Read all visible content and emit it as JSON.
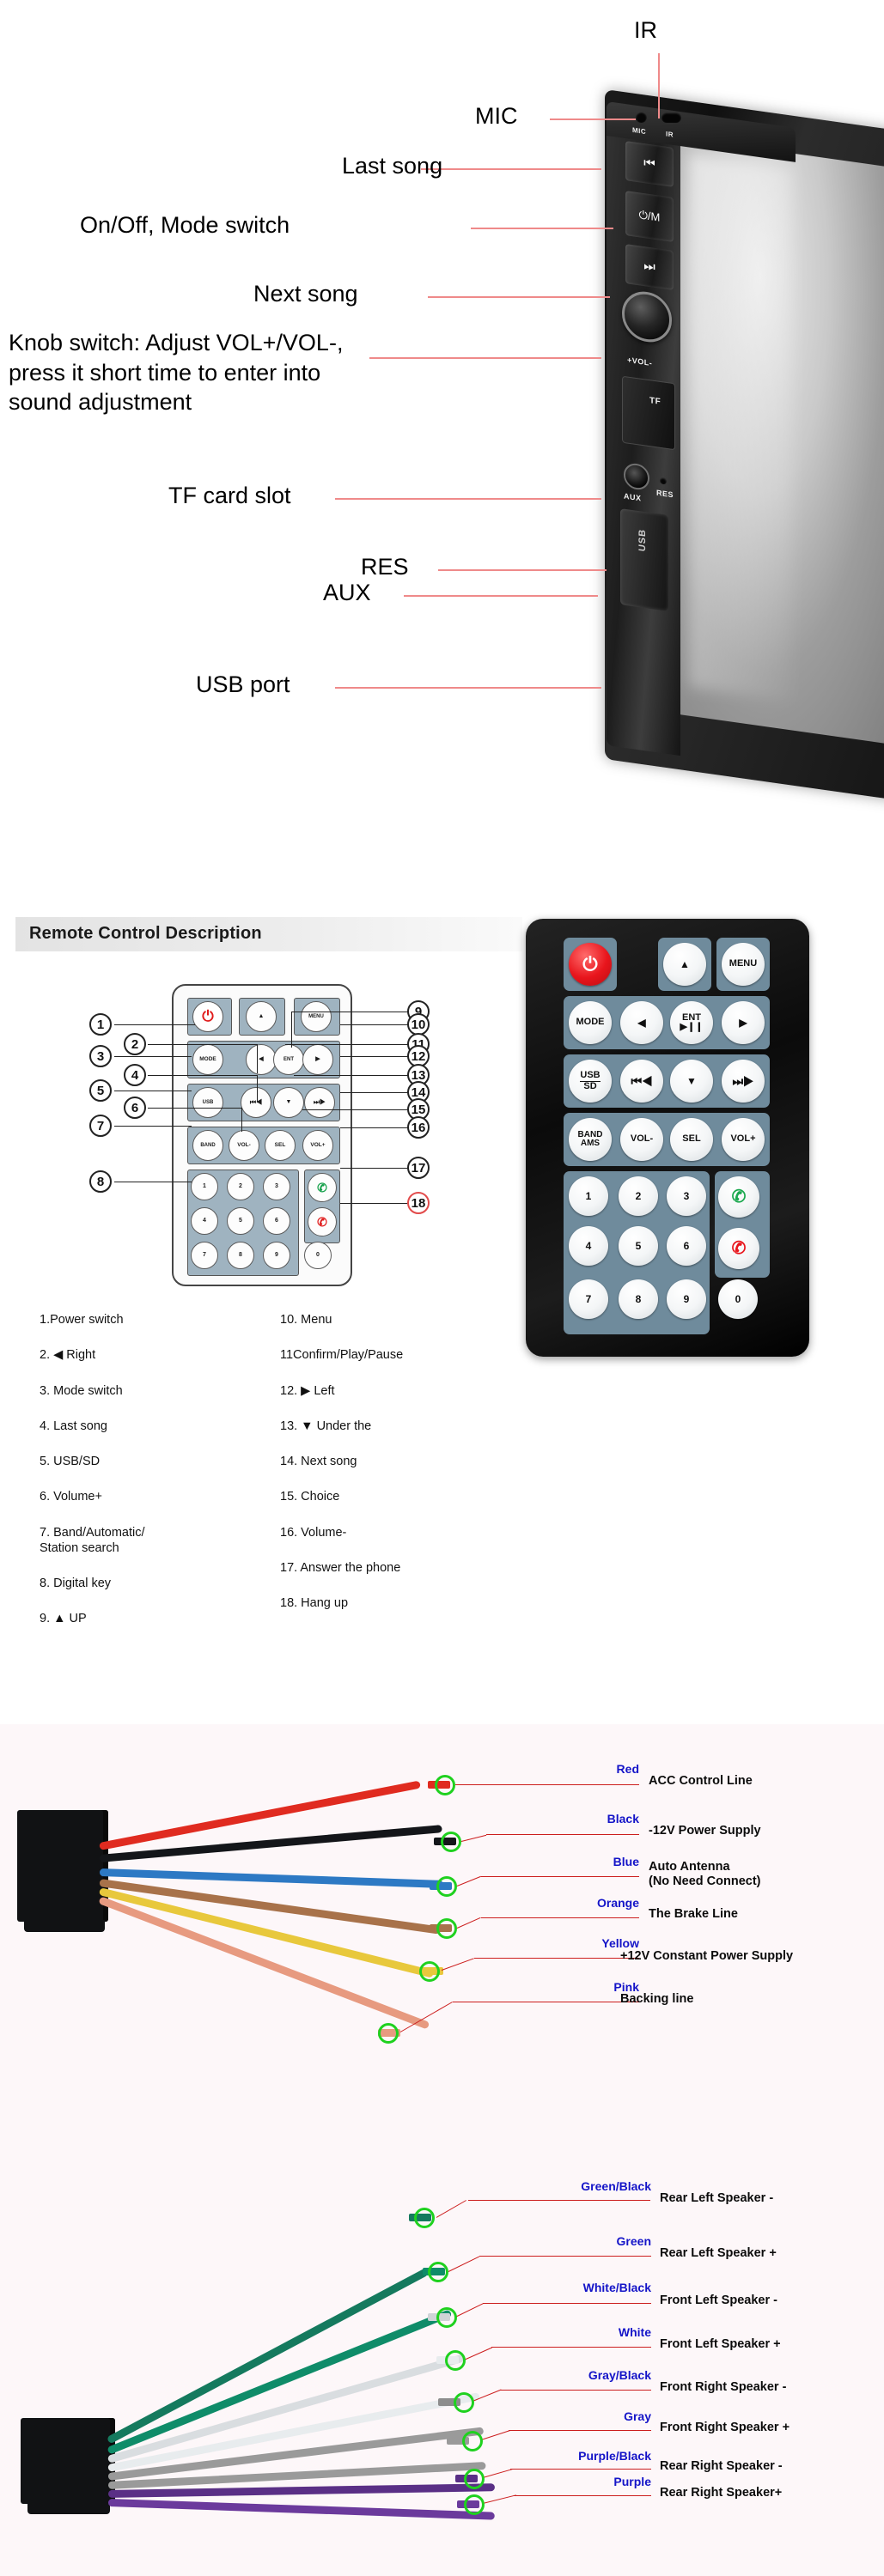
{
  "device": {
    "callouts": [
      {
        "id": "ir",
        "label": "IR"
      },
      {
        "id": "mic",
        "label": "MIC"
      },
      {
        "id": "last-song",
        "label": "Last song"
      },
      {
        "id": "onoff",
        "label": "On/Off, Mode switch"
      },
      {
        "id": "next-song",
        "label": "Next song"
      },
      {
        "id": "knob",
        "label": "Knob switch: Adjust VOL+/VOL-,\npress it short time to enter into\nsound adjustment"
      },
      {
        "id": "tf",
        "label": "TF card slot"
      },
      {
        "id": "res",
        "label": "RES"
      },
      {
        "id": "aux",
        "label": "AUX"
      },
      {
        "id": "usb",
        "label": "USB port"
      }
    ],
    "face_labels": {
      "mic": "MIC",
      "ir": "IR",
      "prev": "⏮",
      "power_mode": "⏻/M",
      "next": "⏭",
      "vol": "+VOL-",
      "tf": "TF",
      "aux": "AUX",
      "res": "RES",
      "usb": "USB"
    }
  },
  "remote": {
    "header": "Remote Control Description",
    "keys": {
      "power": "⏻",
      "up": "▲",
      "menu": "MENU",
      "mode": "MODE",
      "left": "◀",
      "ent": "ENT",
      "ent_sub": "▶❙❙",
      "right": "▶",
      "usbsd_1": "USB",
      "usbsd_2": "SD",
      "prev": "⏮◀",
      "down": "▼",
      "next": "⏭▶",
      "band_1": "BAND",
      "band_2": "AMS",
      "volminus": "VOL-",
      "sel": "SEL",
      "volplus": "VOL+",
      "n1": "1",
      "n2": "2",
      "n3": "3",
      "n4": "4",
      "n5": "5",
      "n6": "6",
      "n7": "7",
      "n8": "8",
      "n9": "9",
      "n0": "0",
      "answer": "✆",
      "hangup": "✆"
    },
    "callout_numbers": [
      "1",
      "2",
      "3",
      "4",
      "5",
      "6",
      "7",
      "8",
      "9",
      "10",
      "11",
      "12",
      "13",
      "14",
      "15",
      "16",
      "17",
      "18"
    ],
    "legend_left": [
      "1.Power switch",
      "2. ◀ Right",
      "3. Mode switch",
      "4. Last song",
      "5. USB/SD",
      "6. Volume+",
      "7. Band/Automatic/\n    Station search",
      "8. Digital key",
      "9. ▲ UP"
    ],
    "legend_right": [
      "10. Menu",
      "11Confirm/Play/Pause",
      "12. ▶  Left",
      "13. ▼  Under the",
      "14. Next song",
      "15. Choice",
      "16. Volume-",
      "17. Answer the phone",
      "18. Hang up"
    ]
  },
  "wiring_power": {
    "rows": [
      {
        "color_name": "Red",
        "description": "ACC Control Line",
        "wire_hex": "#e02b20"
      },
      {
        "color_name": "Black",
        "description": "-12V Power Supply",
        "wire_hex": "#14161a"
      },
      {
        "color_name": "Blue",
        "description": "Auto Antenna\n(No Need Connect)",
        "wire_hex": "#2d79c4"
      },
      {
        "color_name": "Orange",
        "description": "The Brake Line",
        "wire_hex": "#a8724a"
      },
      {
        "color_name": "Yellow",
        "description": "+12V Constant Power Supply",
        "wire_hex": "#e8c83c"
      },
      {
        "color_name": "Pink",
        "description": "Backing line",
        "wire_hex": "#e79a80"
      }
    ]
  },
  "wiring_speaker": {
    "rows": [
      {
        "color_name": "Green/Black",
        "description": "Rear Left Speaker -",
        "wire_hex": "#157a5e"
      },
      {
        "color_name": "Green",
        "description": "Rear Left Speaker +",
        "wire_hex": "#0f8c69"
      },
      {
        "color_name": "White/Black",
        "description": "Front Left Speaker -",
        "wire_hex": "#d9dde0"
      },
      {
        "color_name": "White",
        "description": "Front Left Speaker +",
        "wire_hex": "#e8ecee"
      },
      {
        "color_name": "Gray/Black",
        "description": "Front Right Speaker -",
        "wire_hex": "#9a9a9a"
      },
      {
        "color_name": "Gray",
        "description": "Front Right Speaker +",
        "wire_hex": "#9a9a9a"
      },
      {
        "color_name": "Purple/Black",
        "description": "Rear Right Speaker -",
        "wire_hex": "#5a2f86"
      },
      {
        "color_name": "Purple",
        "description": "Rear Right Speaker+",
        "wire_hex": "#6b3a9c"
      }
    ]
  },
  "colors": {
    "callout_line": "#ef8a8a",
    "wire_lead": "#cc1e1e",
    "wire_color_text": "#1414c8",
    "ring": "#1fd11f",
    "header_bg": "#e9e9e9",
    "remote_pad": "#9fb3c0",
    "wiring_bg": "#fdf7f9"
  }
}
